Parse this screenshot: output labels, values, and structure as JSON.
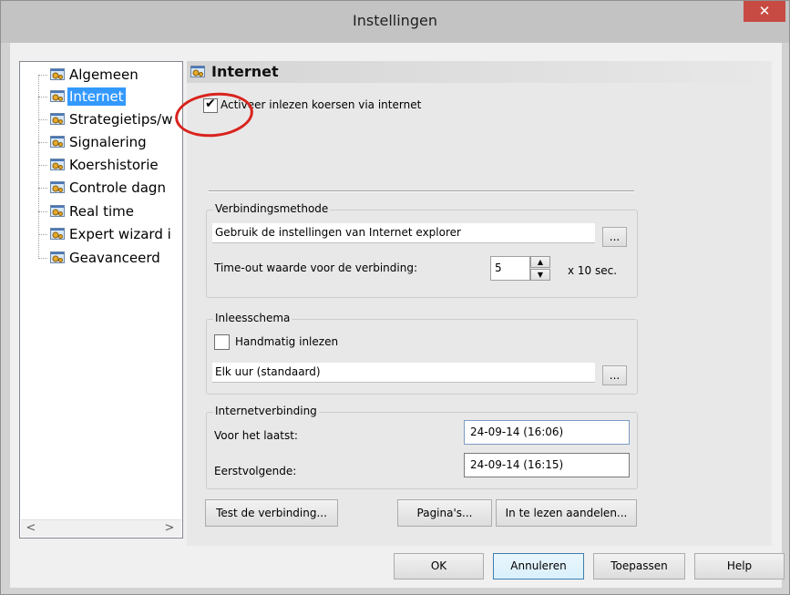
{
  "window": {
    "title": "Instellingen",
    "close_glyph": "✕"
  },
  "tree": {
    "items": [
      {
        "label": "Algemeen",
        "selected": false
      },
      {
        "label": "Internet",
        "selected": true
      },
      {
        "label": "Strategietips/w",
        "selected": false
      },
      {
        "label": "Signalering",
        "selected": false
      },
      {
        "label": "Koershistorie",
        "selected": false
      },
      {
        "label": "Controle dagn",
        "selected": false
      },
      {
        "label": "Real time",
        "selected": false
      },
      {
        "label": "Expert wizard i",
        "selected": false
      },
      {
        "label": "Geavanceerd",
        "selected": false
      }
    ],
    "scroll_left": "<",
    "scroll_right": ">"
  },
  "panel": {
    "header": "Internet",
    "enable_checkbox": {
      "label": "Activeer inlezen koersen via internet",
      "checked": true,
      "mark": "✔"
    },
    "connection_method": {
      "title": "Verbindingsmethode",
      "value": "Gebruik de instellingen van Internet explorer",
      "browse_label": "...",
      "timeout_label": "Time-out waarde voor de verbinding:",
      "timeout_value": "5",
      "timeout_unit": "x 10 sec.",
      "spin_up": "▲",
      "spin_down": "▼"
    },
    "read_schedule": {
      "title": "Inleesschema",
      "manual_label": "Handmatig inlezen",
      "manual_checked": false,
      "value": "Elk uur (standaard)",
      "browse_label": "..."
    },
    "internet_connection": {
      "title": "Internetverbinding",
      "last_label": "Voor het laatst:",
      "last_value": "24-09-14 (16:06)",
      "next_label": "Eerstvolgende:",
      "next_value": "24-09-14 (16:15)"
    },
    "buttons": {
      "test": "Test de verbinding...",
      "pages": "Pagina's...",
      "stocks": "In te lezen aandelen..."
    }
  },
  "footer": {
    "ok": "OK",
    "cancel": "Annuleren",
    "apply": "Toepassen",
    "help": "Help"
  },
  "colors": {
    "selection": "#3399ff",
    "close": "#c74b43",
    "annotation": "#d9231d"
  },
  "icons": {
    "tree_item": "settings-gears-icon"
  }
}
